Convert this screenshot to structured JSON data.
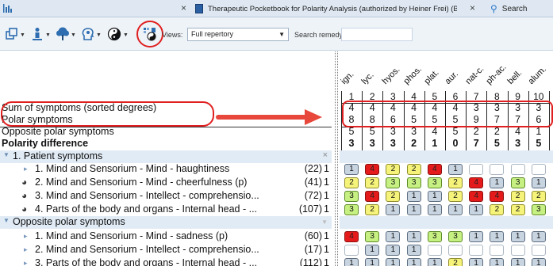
{
  "tabs": {
    "close_glyph": "×",
    "doc_title": "Therapeutic Pocketbook for Polarity Analysis (authorized by Heiner Frei) (BÖNNI...",
    "search_label": "Search"
  },
  "toolbar": {
    "views_label": "Views:",
    "views_value": "Full repertory",
    "search_remedy_label": "Search remedy:",
    "search_remedy_value": "",
    "icons": [
      "window-icon",
      "person-icon",
      "tree-icon",
      "head-profile-icon",
      "yin-yang-icon",
      "polarity-analysis-icon"
    ]
  },
  "summary": {
    "sum_label": "Sum of symptoms (sorted degrees)",
    "polar_label": "Polar symptoms",
    "opposite_label": "Opposite polar symptoms",
    "difference_label": "Polarity difference"
  },
  "remedies": [
    "ign.",
    "lyc.",
    "hyos.",
    "phos.",
    "plat.",
    "aur.",
    "nat-c.",
    "ph-ac.",
    "bell.",
    "alum."
  ],
  "columns": [
    "1",
    "2",
    "3",
    "4",
    "5",
    "6",
    "7",
    "8",
    "9",
    "10"
  ],
  "summary_values": {
    "sum": [
      "4",
      "4",
      "4",
      "4",
      "4",
      "4",
      "3",
      "3",
      "3",
      "3"
    ],
    "polar": [
      "8",
      "8",
      "6",
      "5",
      "5",
      "5",
      "9",
      "7",
      "7",
      "6"
    ],
    "opposite": [
      "5",
      "5",
      "3",
      "3",
      "4",
      "5",
      "2",
      "2",
      "4",
      "1"
    ],
    "difference": [
      "3",
      "3",
      "3",
      "2",
      "1",
      "0",
      "7",
      "5",
      "3",
      "5"
    ]
  },
  "groups": [
    {
      "title": "1. Patient symptoms",
      "close": "×",
      "rows": [
        {
          "marker": "▸",
          "text": "1. Mind and Sensorium - Mind - haughtiness",
          "count": "(22)",
          "degree": "1",
          "cells": [
            1,
            4,
            2,
            2,
            4,
            1,
            0,
            0,
            0,
            0
          ]
        },
        {
          "marker": "◕",
          "text": "2. Mind and Sensorium - Mind - cheerfulness (p)",
          "count": "(41)",
          "degree": "1",
          "cells": [
            2,
            2,
            3,
            3,
            3,
            2,
            4,
            1,
            3,
            1
          ]
        },
        {
          "marker": "◕",
          "text": "3. Mind and Sensorium - Intellect - comprehensio...",
          "count": "(72)",
          "degree": "1",
          "cells": [
            3,
            4,
            2,
            1,
            1,
            2,
            4,
            4,
            2,
            2
          ]
        },
        {
          "marker": "◕",
          "text": "4. Parts of the body and organs - Internal head - ...",
          "count": "(107)",
          "degree": "1",
          "cells": [
            3,
            2,
            1,
            1,
            1,
            1,
            1,
            2,
            2,
            3
          ]
        }
      ]
    },
    {
      "title": "Opposite polar symptoms",
      "close": "",
      "rows": [
        {
          "marker": "▸",
          "text": "1. Mind and Sensorium - Mind - sadness (p)",
          "count": "(60)",
          "degree": "1",
          "cells": [
            4,
            3,
            1,
            1,
            3,
            3,
            1,
            1,
            1,
            1
          ]
        },
        {
          "marker": "▸",
          "text": "2. Mind and Sensorium - Intellect - comprehensio...",
          "count": "(17)",
          "degree": "1",
          "cells": [
            0,
            1,
            1,
            1,
            0,
            0,
            0,
            0,
            0,
            0
          ]
        },
        {
          "marker": "▸",
          "text": "3. Parts of the body and organs - Internal head - ...",
          "count": "(112)",
          "degree": "1",
          "cells": [
            1,
            1,
            1,
            1,
            1,
            2,
            1,
            1,
            1,
            1
          ]
        }
      ]
    }
  ],
  "colors": {
    "degree_1": "#c8d4e0",
    "degree_2": "#f5f37a",
    "degree_3": "#c6f081",
    "degree_4": "#e51b1b",
    "annotation": "#e02020",
    "group_band": "#e1ebf5"
  }
}
